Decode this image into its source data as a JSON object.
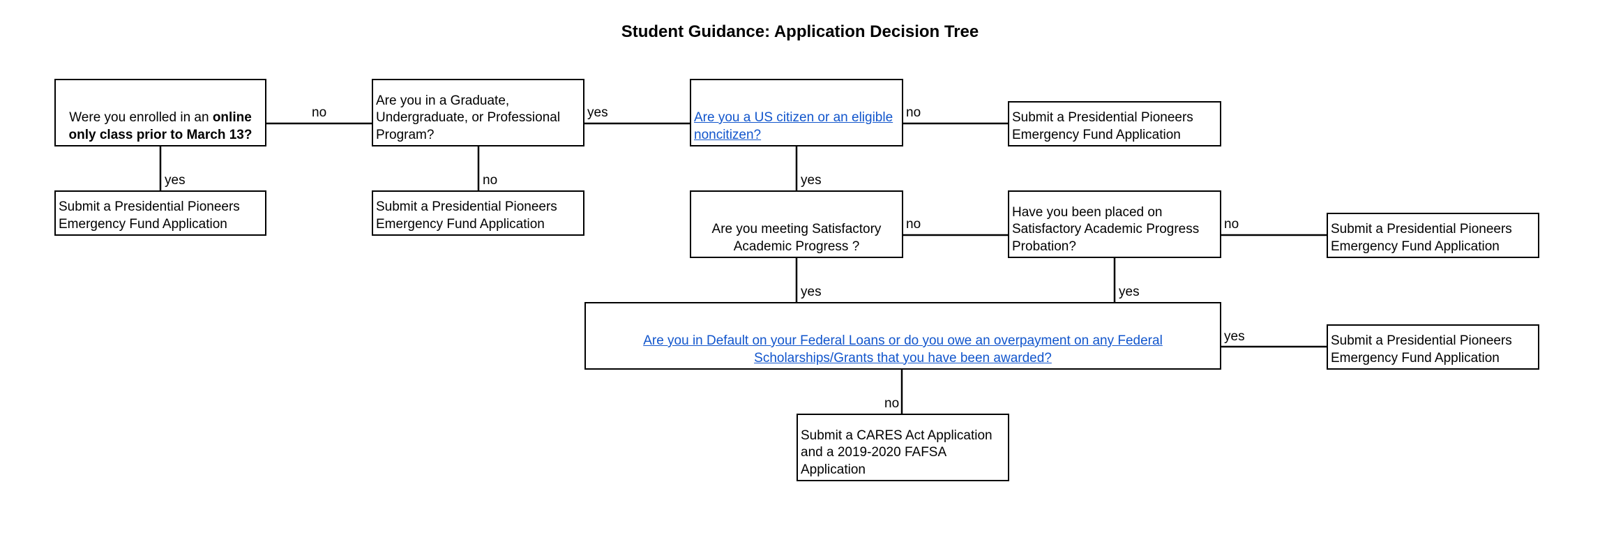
{
  "title": "Student Guidance: Application Decision Tree",
  "colors": {
    "link": "#1155cc",
    "stroke": "#000000",
    "background": "#ffffff"
  },
  "nodes": {
    "online_only": {
      "text_plain": "Were you enrolled in an ",
      "text_bold": "online only class prior to March 13?"
    },
    "online_yes_result": {
      "text": "Submit a Presidential Pioneers Emergency Fund Application"
    },
    "program": {
      "text": "Are you in a Graduate, Undergraduate, or Professional Program?"
    },
    "program_no_result": {
      "text": "Submit a Presidential Pioneers Emergency Fund Application"
    },
    "citizen": {
      "text": "Are you a US citizen or an eligible noncitizen?",
      "is_link": true
    },
    "citizen_no_result": {
      "text": "Submit a Presidential Pioneers Emergency Fund Application"
    },
    "sap": {
      "text": "Are you meeting Satisfactory Academic Progress ?"
    },
    "probation": {
      "text": "Have you been placed on Satisfactory Academic Progress Probation?"
    },
    "probation_no_result": {
      "text": "Submit a Presidential Pioneers Emergency Fund Application"
    },
    "default": {
      "text": "Are you in Default on your Federal Loans or do you owe an overpayment on any Federal Scholarships/Grants that you have been awarded?",
      "is_link": true
    },
    "default_yes_result": {
      "text": "Submit a Presidential Pioneers Emergency Fund Application"
    },
    "cares": {
      "text": "Submit a CARES Act Application and a 2019-2020 FAFSA Application"
    }
  },
  "edges": [
    {
      "from": "online_only",
      "to": "program",
      "label": "no"
    },
    {
      "from": "online_only",
      "to": "online_yes_result",
      "label": "yes"
    },
    {
      "from": "program",
      "to": "citizen",
      "label": "yes"
    },
    {
      "from": "program",
      "to": "program_no_result",
      "label": "no"
    },
    {
      "from": "citizen",
      "to": "citizen_no_result",
      "label": "no"
    },
    {
      "from": "citizen",
      "to": "sap",
      "label": "yes"
    },
    {
      "from": "sap",
      "to": "probation",
      "label": "no"
    },
    {
      "from": "sap",
      "to": "default",
      "label": "yes"
    },
    {
      "from": "probation",
      "to": "probation_no_result",
      "label": "no"
    },
    {
      "from": "probation",
      "to": "default",
      "label": "yes"
    },
    {
      "from": "default",
      "to": "default_yes_result",
      "label": "yes"
    },
    {
      "from": "default",
      "to": "cares",
      "label": "no"
    }
  ]
}
